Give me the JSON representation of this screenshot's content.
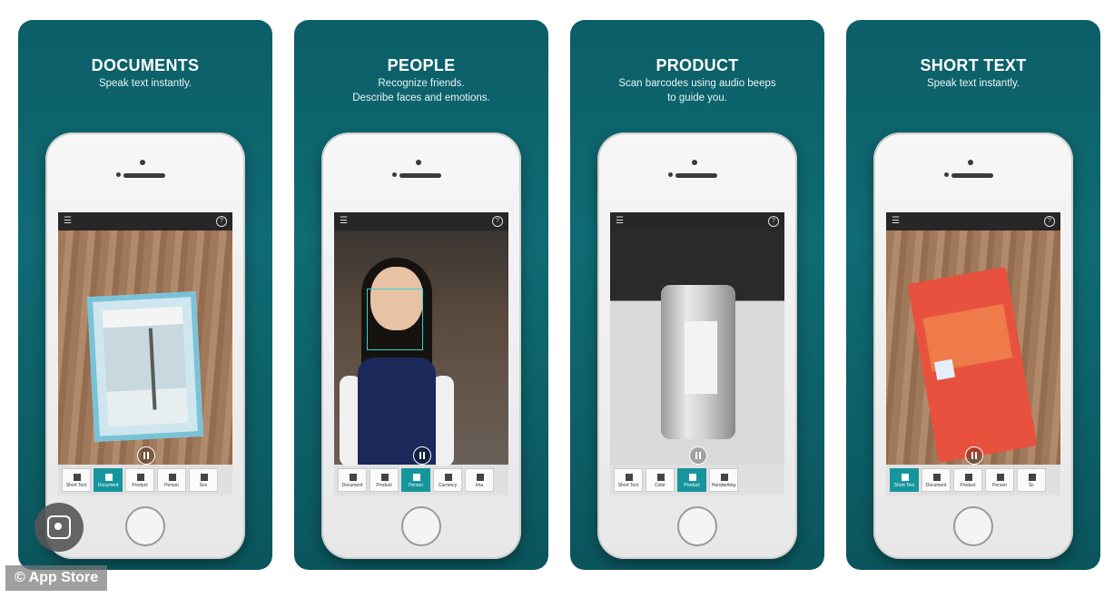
{
  "panels": [
    {
      "title": "DOCUMENTS",
      "subtitle": "Speak text instantly.",
      "modes": [
        "Short Text",
        "Document",
        "Product",
        "Person",
        "Sce"
      ]
    },
    {
      "title": "PEOPLE",
      "subtitle": "Recognize friends.\nDescribe faces and emotions.",
      "modes": [
        "Document",
        "Product",
        "Person",
        "Currency",
        "Ima"
      ]
    },
    {
      "title": "PRODUCT",
      "subtitle": "Scan barcodes using audio beeps\nto guide you.",
      "modes": [
        "Short Text",
        "Color",
        "Product",
        "Handwriting"
      ]
    },
    {
      "title": "SHORT TEXT",
      "subtitle": "Speak text instantly.",
      "modes": [
        "Short Text",
        "Document",
        "Product",
        "Person",
        "Sc"
      ]
    }
  ],
  "credit": "© App Store",
  "icons": {
    "menu": "menu-icon",
    "help": "help-icon",
    "pause": "pause-icon",
    "lens": "lens-search-icon"
  }
}
